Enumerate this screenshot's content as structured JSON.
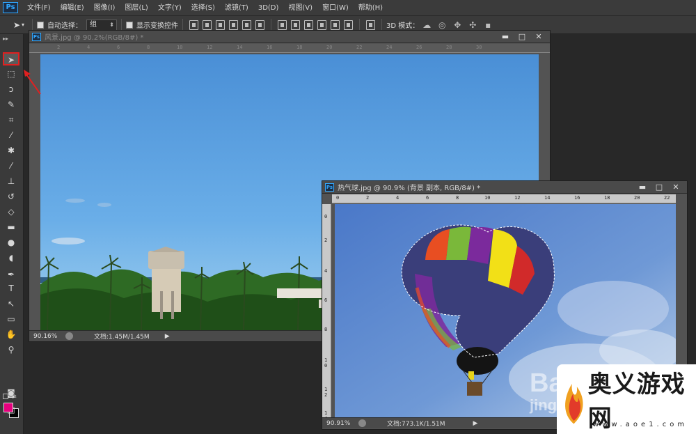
{
  "app": {
    "logo": "Ps"
  },
  "menu": [
    "文件(F)",
    "编辑(E)",
    "图像(I)",
    "图层(L)",
    "文字(Y)",
    "选择(S)",
    "滤镜(T)",
    "3D(D)",
    "视图(V)",
    "窗口(W)",
    "帮助(H)"
  ],
  "options": {
    "auto_select_label": "自动选择：",
    "auto_select_value": "组",
    "show_transform_label": "显示变换控件",
    "mode3d_label": "3D 模式："
  },
  "window_landscape": {
    "title": "风景.jpg @ 90.2%(RGB/8#) *",
    "zoom": "90.16%",
    "doc_info": "文档:1.45M/1.45M",
    "ruler_marks": [
      "2",
      "4",
      "6",
      "8",
      "10",
      "12",
      "14",
      "16",
      "18",
      "20",
      "22",
      "24",
      "26",
      "28",
      "30"
    ]
  },
  "window_balloon": {
    "title": "热气球.jpg @ 90.9% (背景 副本, RGB/8#) *",
    "zoom": "90.91%",
    "doc_info": "文档:773.1K/1.51M",
    "ruler_h_marks": [
      "0",
      "2",
      "4",
      "6",
      "8",
      "10",
      "12",
      "14",
      "16",
      "18",
      "20",
      "22"
    ],
    "ruler_v_marks": [
      "0",
      "2",
      "4",
      "6",
      "8",
      "1",
      "0",
      "1",
      "2",
      "1",
      "4"
    ]
  },
  "window_buttons": {
    "minimize": "▬",
    "maximize": "□",
    "close": "✕"
  },
  "watermark": {
    "name": "奥义游戏网",
    "url": "www.aoe1.com",
    "bai": "Ba",
    "jing": "jing"
  },
  "colors": {
    "foreground": "#e6007e",
    "background": "#000000",
    "highlight": "#e02020"
  }
}
